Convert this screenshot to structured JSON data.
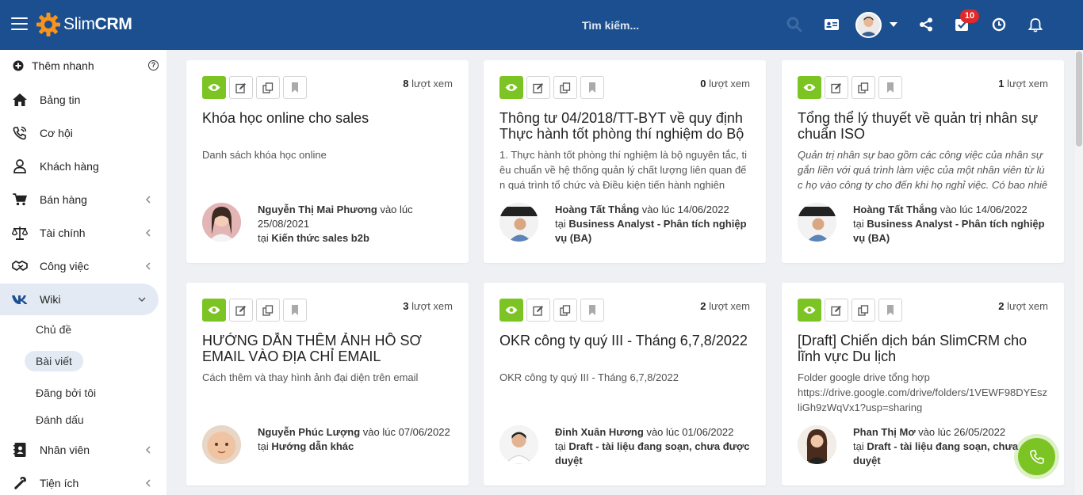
{
  "app": {
    "logo_prefix": "Slim",
    "logo_suffix": "CRM",
    "search_placeholder": "Tìm kiếm...",
    "notification_count": "10",
    "brand_color": "#1c4f8f",
    "accent_color": "#7cc423"
  },
  "header_icons": [
    "search-icon",
    "contact-card-icon",
    "share-icon",
    "task-check-icon",
    "clock-icon",
    "bell-icon"
  ],
  "sidebar": {
    "quick_add": "Thêm nhanh",
    "items": [
      {
        "label": "Bảng tin",
        "icon": "home-icon"
      },
      {
        "label": "Cơ hội",
        "icon": "phone-signal-icon"
      },
      {
        "label": "Khách hàng",
        "icon": "user-icon"
      },
      {
        "label": "Bán hàng",
        "icon": "cart-icon"
      },
      {
        "label": "Tài chính",
        "icon": "scale-icon"
      },
      {
        "label": "Công việc",
        "icon": "handshake-icon"
      },
      {
        "label": "Wiki",
        "icon": "vk-icon"
      },
      {
        "label": "Nhân viên",
        "icon": "contact-book-icon"
      },
      {
        "label": "Tiện ích",
        "icon": "wrench-icon"
      }
    ],
    "wiki_sub": [
      "Chủ đề",
      "Bài viết",
      "Đăng bởi tôi",
      "Đánh dấu"
    ]
  },
  "cards": [
    {
      "views": "8",
      "views_label": "lượt xem",
      "title": "Khóa học online cho sales",
      "desc": "Danh sách khóa học online",
      "author": "Nguyễn Thị Mai Phương",
      "at_label": "vào lúc",
      "date": "25/08/2021",
      "in_label": "tại",
      "category": "Kiến thức sales b2b"
    },
    {
      "views": "0",
      "views_label": "lượt xem",
      "title": "Thông tư 04/2018/TT-BYT về quy định Thực hành tốt phòng thí nghiệm do Bộ",
      "desc": "1. Thực hành tốt phòng thí nghiệm là bộ nguyên tắc, tiêu chuẩn về hệ thống quản lý chất lượng liên quan đến quá trình tổ chức và Điều kiện tiến hành nghiên",
      "author": "Hoàng Tất Thắng",
      "at_label": "vào lúc",
      "date": "14/06/2022",
      "in_label": "tại",
      "category": "Business Analyst - Phân tích nghiệp vụ (BA)"
    },
    {
      "views": "1",
      "views_label": "lượt xem",
      "title": "Tổng thể lý thuyết về quản trị nhân sự chuẩn ISO",
      "desc": "Quản trị nhân sự bao gồm các công việc của nhân sự gắn liền với quá trình làm việc của một nhân viên từ lúc họ vào công ty cho đến khi họ nghỉ việc. Có bao nhiêu",
      "author": "Hoàng Tất Thắng",
      "at_label": "vào lúc",
      "date": "14/06/2022",
      "in_label": "tại",
      "category": "Business Analyst - Phân tích nghiệp vụ (BA)"
    },
    {
      "views": "3",
      "views_label": "lượt xem",
      "title": "HƯỚNG DẪN THÊM ẢNH HỒ SƠ EMAIL VÀO ĐỊA CHỈ EMAIL SLIMCRM.VN",
      "desc": "Cách thêm và thay hình ảnh đại diện trên email",
      "author": "Nguyễn Phúc Lượng",
      "at_label": "vào lúc",
      "date": "07/06/2022",
      "in_label": "tại",
      "category": "Hướng dẫn khác"
    },
    {
      "views": "2",
      "views_label": "lượt xem",
      "title": "OKR công ty quý III - Tháng 6,7,8/2022",
      "desc": "OKR công ty quý III - Tháng 6,7,8/2022",
      "author": "Đinh Xuân Hương",
      "at_label": "vào lúc",
      "date": "01/06/2022",
      "in_label": "tại",
      "category": "Draft - tài liệu đang soạn, chưa được duyệt"
    },
    {
      "views": "2",
      "views_label": "lượt xem",
      "title": "[Draft] Chiến dịch bán SlimCRM cho lĩnh vực Du lịch",
      "desc": "Folder google drive tổng hợp\nhttps://drive.google.com/drive/folders/1VEWF98DYEszliGh9zWqVx1?usp=sharing",
      "author": "Phan Thị Mơ",
      "at_label": "vào lúc",
      "date": "26/05/2022",
      "in_label": "tại",
      "category": "Draft - tài liệu đang soạn, chưa được duyệt"
    }
  ]
}
